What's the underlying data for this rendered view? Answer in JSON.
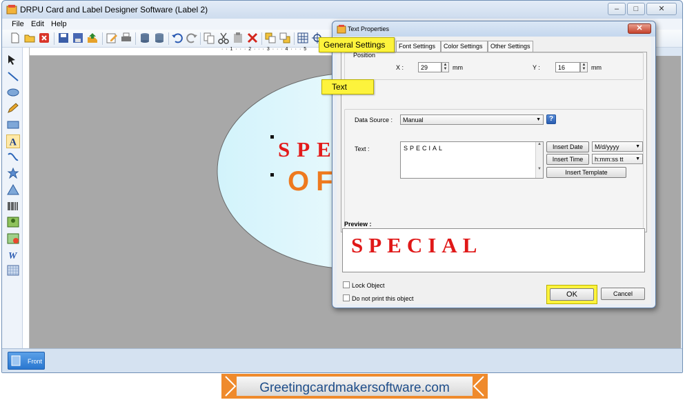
{
  "window": {
    "title": "DRPU Card and Label Designer Software  (Label 2)",
    "controls": [
      "minimize",
      "maximize",
      "close"
    ]
  },
  "menu": [
    "File",
    "Edit",
    "Help"
  ],
  "ruler_marks": "· · 1 · · · 2 · · · 3 · · · 4 · · · 5",
  "canvas": {
    "line1": "SPE",
    "line2": "OF",
    "colors": {
      "line1": "#e31b1b",
      "line2": "#ee7a1f",
      "ellipse": "#d9f5fb"
    }
  },
  "status": {
    "front_tab": "Front"
  },
  "dialog": {
    "title": "Text Properties",
    "tabs": [
      "General Settings",
      "Font Settings",
      "Color Settings",
      "Other Settings"
    ],
    "position": {
      "legend": "Position",
      "x_label": "X :",
      "x_value": "29",
      "x_unit": "mm",
      "y_label": "Y :",
      "y_value": "16",
      "y_unit": "mm"
    },
    "data_source": {
      "label": "Data Source :",
      "value": "Manual"
    },
    "text": {
      "label": "Text :",
      "value": "SPECIAL",
      "insert_date": "Insert Date",
      "date_format": "M/d/yyyy",
      "insert_time": "Insert Time",
      "time_format": "h:mm:ss tt",
      "insert_template": "Insert Template"
    },
    "preview": {
      "label": "Preview :",
      "text": "SPECIAL",
      "color": "#e01818"
    },
    "lock_object": "Lock Object",
    "do_not_print": "Do not print this object",
    "ok": "OK",
    "cancel": "Cancel"
  },
  "callouts": {
    "general_settings": "General Settings",
    "text": "Text",
    "ok": "OK"
  },
  "banner": {
    "text": "Greetingcardmakersoftware.com"
  }
}
